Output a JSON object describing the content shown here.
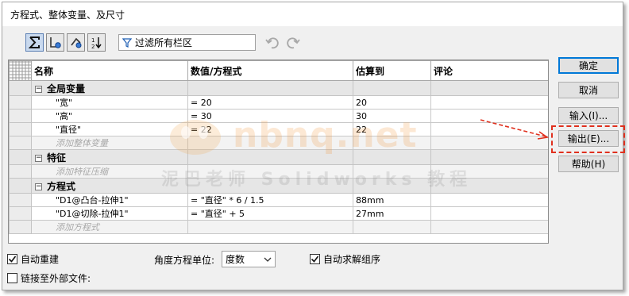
{
  "window": {
    "title": "方程式、整体变量、及尺寸"
  },
  "toolbar": {
    "filter_text": "过滤所有栏区",
    "buttons": [
      "equation-view-icon",
      "sketch-equation-view-icon",
      "dimension-view-icon",
      "ordered-view-icon"
    ]
  },
  "table": {
    "headers": {
      "name": "名称",
      "value": "数值/方程式",
      "evaluates": "估算到",
      "comment": "评论"
    },
    "groups": {
      "globals": {
        "label": "全局变量",
        "rows": [
          {
            "name": "\"宽\"",
            "value": "= 20",
            "evaluates": "20"
          },
          {
            "name": "\"高\"",
            "value": "= 30",
            "evaluates": "30"
          },
          {
            "name": "\"直径\"",
            "value": "= 22",
            "evaluates": "22"
          }
        ],
        "add_placeholder": "添加整体变量"
      },
      "features": {
        "label": "特征",
        "add_placeholder": "添加特征压缩"
      },
      "equations": {
        "label": "方程式",
        "rows": [
          {
            "name": "\"D1@凸台-拉伸1\"",
            "value": "= \"直径\" * 6 / 1.5",
            "evaluates": "88mm"
          },
          {
            "name": "\"D1@切除-拉伸1\"",
            "value": "= \"直径\" + 5",
            "evaluates": "27mm"
          }
        ],
        "add_placeholder": "添加方程式"
      }
    }
  },
  "buttons": {
    "ok": "确定",
    "cancel": "取消",
    "import": "输入(I)...",
    "export": "输出(E)...",
    "help": "帮助(H)"
  },
  "options": {
    "auto_rebuild": {
      "label": "自动重建",
      "checked": true
    },
    "angle_unit_label": "角度方程单位:",
    "angle_unit_value": "度数",
    "auto_solve_order": {
      "label": "自动求解组序",
      "checked": true
    },
    "link_external": {
      "label": "链接至外部文件:",
      "checked": false
    }
  },
  "watermark": {
    "line1": "nbnq.net",
    "line2": "泥巴老师 Solidworks 教程"
  },
  "colors": {
    "accent": "#0078d7",
    "highlight": "#e0301e",
    "group_bg": "#e6e6e6"
  }
}
